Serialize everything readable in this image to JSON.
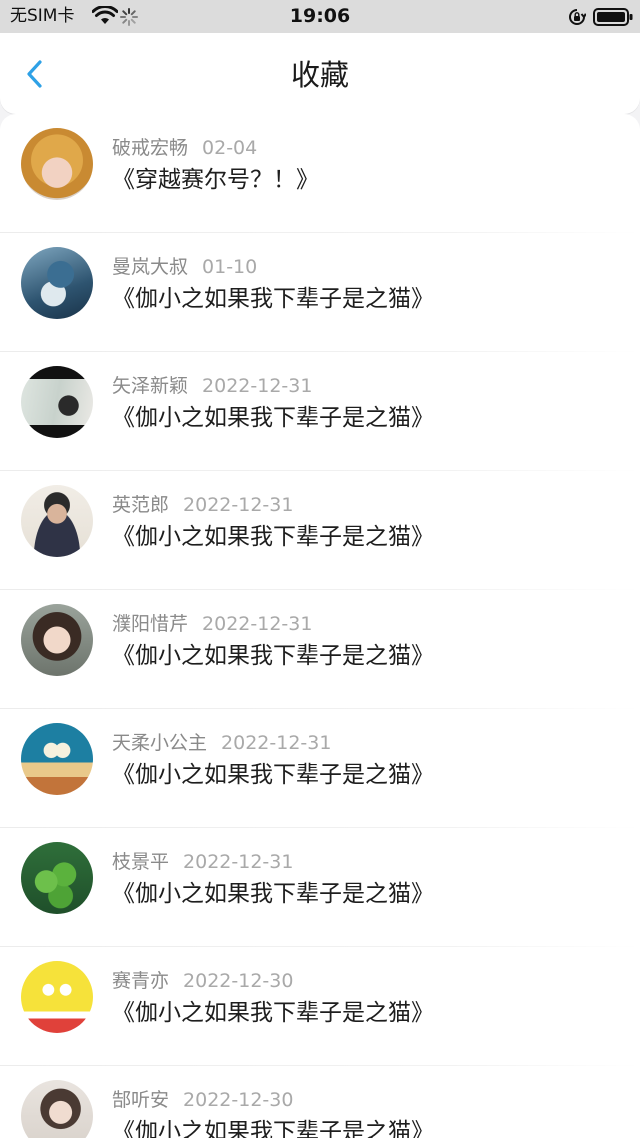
{
  "status_bar": {
    "carrier": "无SIM卡",
    "time": "19:06"
  },
  "nav": {
    "title": "收藏",
    "back_icon": "chevron-left-icon",
    "accent": "#2ea1e6"
  },
  "items": [
    {
      "name": "破戒宏畅",
      "date": "02-04",
      "post": "《穿越赛尔号？！》"
    },
    {
      "name": "曼岚大叔",
      "date": "01-10",
      "post": "《伽小之如果我下辈子是之猫》"
    },
    {
      "name": "矢泽新颖",
      "date": "2022-12-31",
      "post": "《伽小之如果我下辈子是之猫》"
    },
    {
      "name": "英范郎",
      "date": "2022-12-31",
      "post": "《伽小之如果我下辈子是之猫》"
    },
    {
      "name": "濮阳惜芹",
      "date": "2022-12-31",
      "post": "《伽小之如果我下辈子是之猫》"
    },
    {
      "name": "天柔小公主",
      "date": "2022-12-31",
      "post": "《伽小之如果我下辈子是之猫》"
    },
    {
      "name": "枝景平",
      "date": "2022-12-31",
      "post": "《伽小之如果我下辈子是之猫》"
    },
    {
      "name": "赛青亦",
      "date": "2022-12-30",
      "post": "《伽小之如果我下辈子是之猫》"
    },
    {
      "name": "郜听安",
      "date": "2022-12-30",
      "post": "《伽小之如果我下辈子是之猫》"
    }
  ]
}
